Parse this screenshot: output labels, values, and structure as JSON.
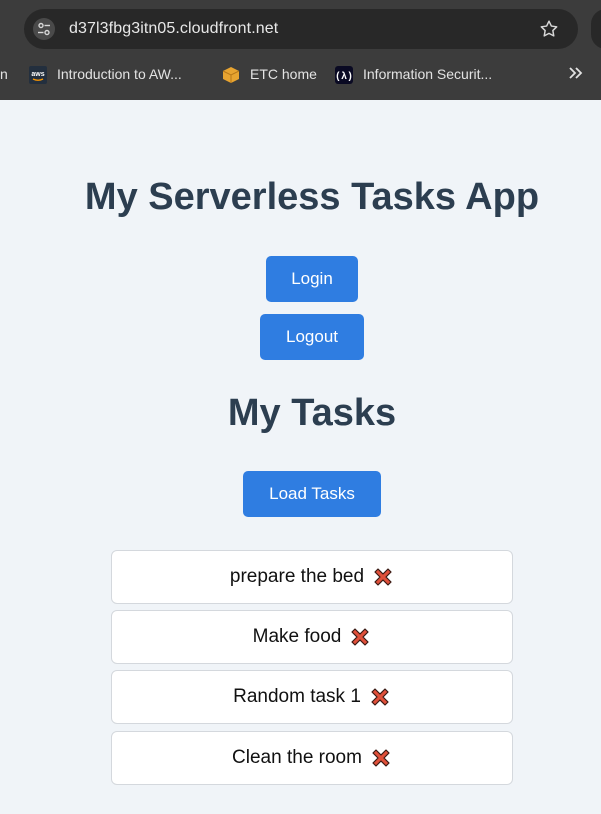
{
  "browser": {
    "url": "d37l3fbg3itn05.cloudfront.net",
    "bookmarks": [
      {
        "label": "n",
        "icon": "truncated"
      },
      {
        "label": "Introduction to AW...",
        "icon": "aws-logo-icon"
      },
      {
        "label": "ETC home",
        "icon": "box-icon"
      },
      {
        "label": "Information Securit...",
        "icon": "code-icon"
      }
    ]
  },
  "app": {
    "title": "My Serverless Tasks App",
    "login_label": "Login",
    "logout_label": "Logout",
    "tasks_heading": "My Tasks",
    "load_tasks_label": "Load Tasks",
    "tasks": [
      {
        "text": "prepare the bed"
      },
      {
        "text": "Make food"
      },
      {
        "text": "Random task 1"
      },
      {
        "text": "Clean the room"
      }
    ]
  },
  "colors": {
    "button_bg": "#2f7de1",
    "heading": "#2c3e50",
    "page_bg": "#f0f4f8",
    "delete_icon": "#e0503a"
  }
}
